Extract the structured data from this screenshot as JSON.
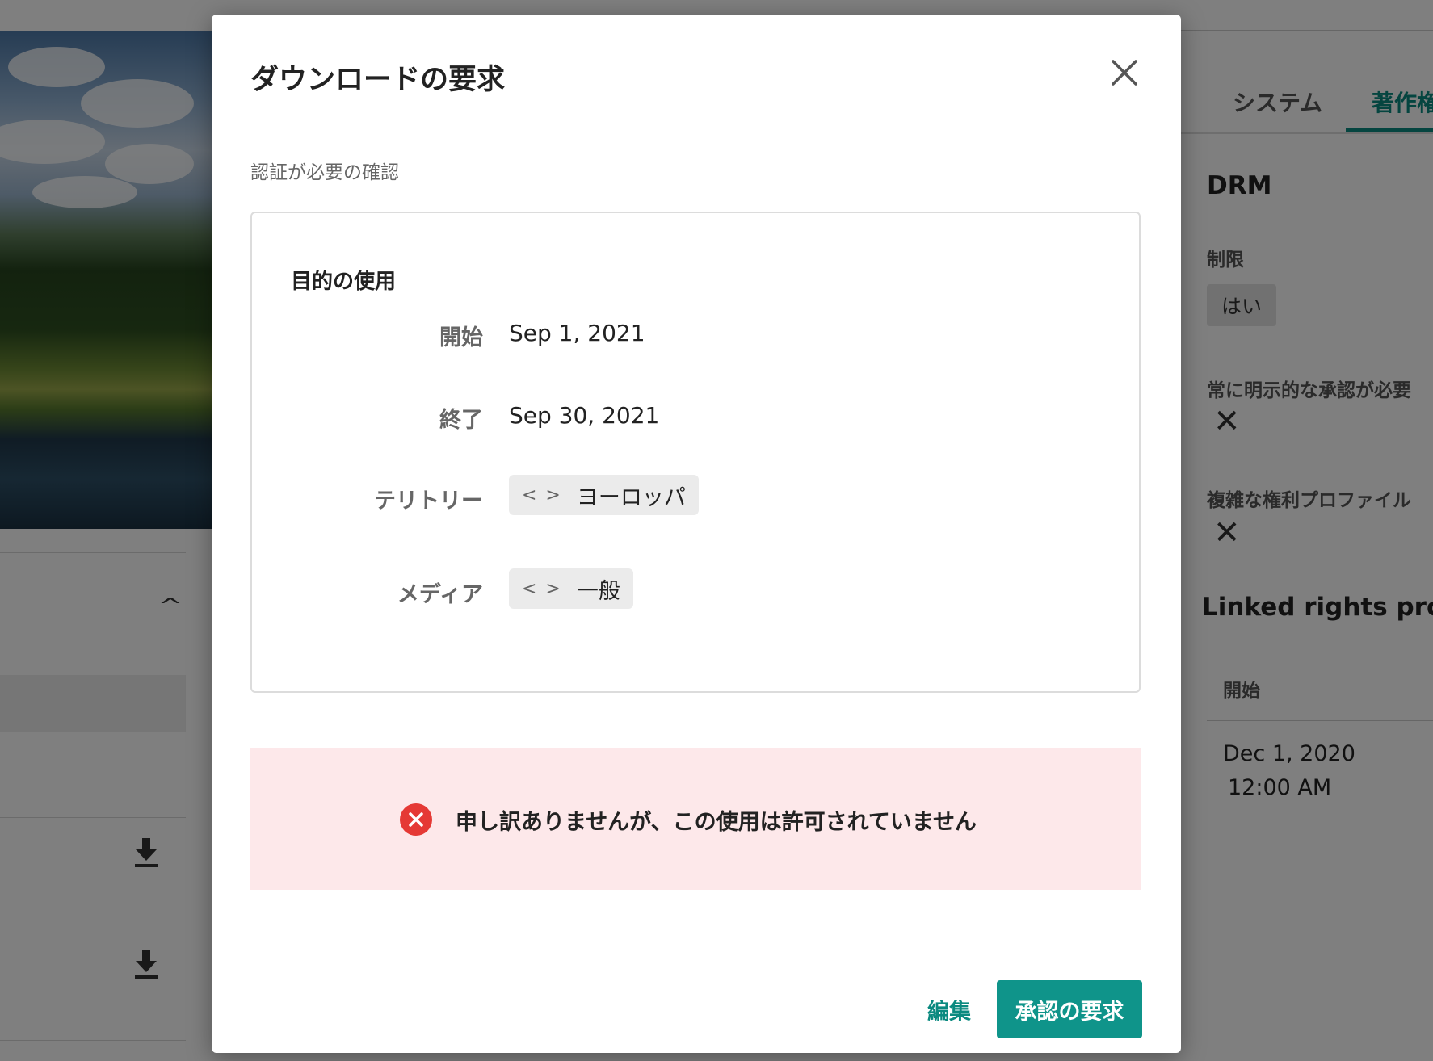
{
  "background": {
    "tabs": [
      {
        "label": "システム",
        "active": false
      },
      {
        "label": "著作権",
        "active": true
      }
    ],
    "section_title": "DRM",
    "restriction_label": "制限",
    "restriction_value": "はい",
    "explicit_approval_label": "常に明示的な承認が必要",
    "complex_rights_label": "複雑な権利プロファイル",
    "linked_rights_title": "Linked rights profil",
    "table_header_start": "開始",
    "table_cell_date": "Dec 1, 2020",
    "table_cell_time": "12:00 AM"
  },
  "modal": {
    "title": "ダウンロードの要求",
    "subtitle": "認証が必要の確認",
    "card": {
      "title": "目的の使用",
      "rows": [
        {
          "label": "開始",
          "value": "Sep 1, 2021"
        },
        {
          "label": "終了",
          "value": "Sep 30, 2021"
        },
        {
          "label": "テリトリー",
          "value": "ヨーロッパ"
        },
        {
          "label": "メディア",
          "value": "一般"
        }
      ]
    },
    "error_message": "申し訳ありませんが、この使用は許可されていません",
    "buttons": {
      "edit": "編集",
      "request_approval": "承認の要求"
    }
  },
  "colors": {
    "accent": "#0f948a",
    "error_bg": "#fde8ea",
    "error_icon": "#e53935"
  }
}
